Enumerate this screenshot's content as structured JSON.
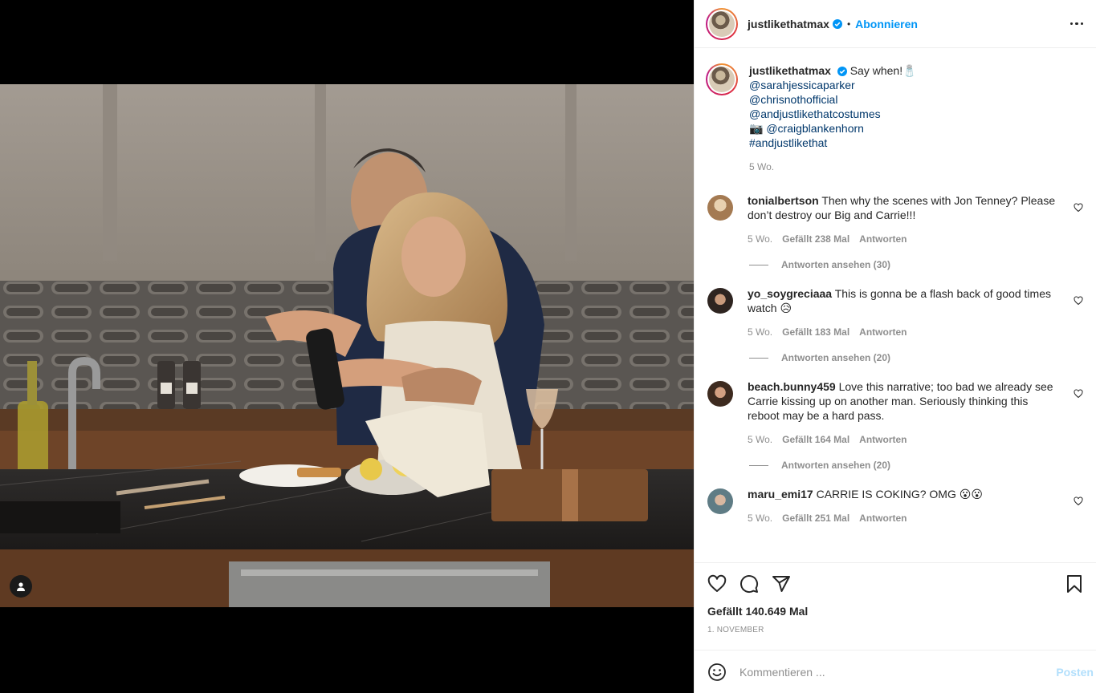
{
  "header": {
    "username": "justlikethatmax",
    "separator": "•",
    "follow_label": "Abonnieren"
  },
  "caption": {
    "username": "justlikethatmax",
    "text": "Say when!🧂",
    "mentions": [
      "@sarahjessicaparker",
      "@chrisnothofficial",
      "@andjustlikethatcostumes"
    ],
    "photo_credit_icon": "📷",
    "photo_credit": "@craigblankenhorn",
    "hashtag": "#andjustlikethat",
    "age": "5 Wo."
  },
  "comments": [
    {
      "username": "tonialbertson",
      "text": "Then why the scenes with Jon Tenney? Please don’t destroy our Big and Carrie!!!",
      "age": "5 Wo.",
      "likes": "Gefällt 238 Mal",
      "reply_label": "Antworten",
      "view_replies": "Antworten ansehen (30)",
      "avatar_color": "#c9a27a"
    },
    {
      "username": "yo_soygreciaaa",
      "text": "This is gonna be a flash back of good times watch 😥",
      "age": "5 Wo.",
      "likes": "Gefällt 183 Mal",
      "reply_label": "Antworten",
      "view_replies": "Antworten ansehen (20)",
      "avatar_color": "#3b2f2a"
    },
    {
      "username": "beach.bunny459",
      "text": "Love this narrative; too bad we already see Carrie kissing up on another man. Seriously thinking this reboot may be a hard pass.",
      "age": "5 Wo.",
      "likes": "Gefällt 164 Mal",
      "reply_label": "Antworten",
      "view_replies": "Antworten ansehen (20)",
      "avatar_color": "#4a3528"
    },
    {
      "username": "maru_emi17",
      "text": "CARRIE IS COKING? OMG 😮😮",
      "age": "5 Wo.",
      "likes": "Gefällt 251 Mal",
      "reply_label": "Antworten",
      "avatar_color": "#6e8b92"
    }
  ],
  "post": {
    "likes_label": "Gefällt 140.649 Mal",
    "date": "1. November"
  },
  "composer": {
    "placeholder": "Kommentieren ...",
    "post_label": "Posten"
  },
  "icons": {
    "tag": "person-tag-icon",
    "verified": "verified-badge-icon",
    "more": "more-options-icon",
    "like": "heart-icon",
    "comment": "comment-bubble-icon",
    "share": "paper-plane-icon",
    "save": "bookmark-icon",
    "emoji": "emoji-smiley-icon"
  },
  "colors": {
    "accent": "#0095f6",
    "link": "#00376b",
    "muted": "#8e8e8e",
    "post_disabled": "#b2dffc",
    "verified": "#0095f6"
  }
}
